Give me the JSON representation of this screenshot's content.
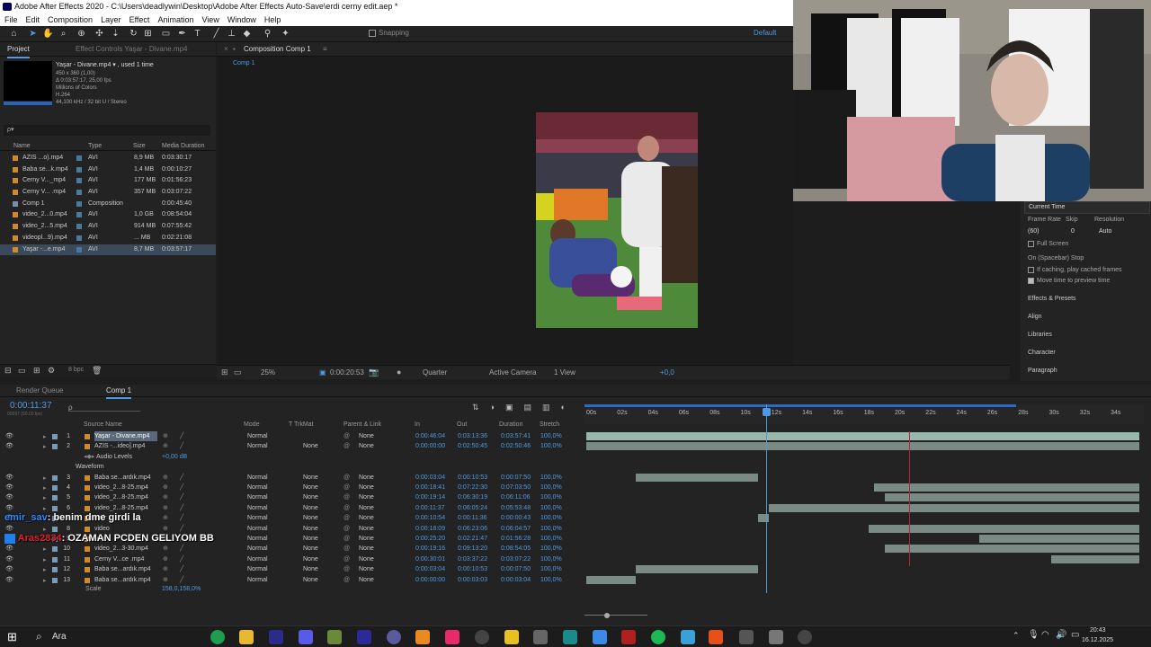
{
  "window": {
    "title": "Adobe After Effects 2020 - C:\\Users\\deadlywin\\Desktop\\Adobe After Effects Auto-Save\\erdi cerny edit.aep *"
  },
  "menu": [
    "File",
    "Edit",
    "Composition",
    "Layer",
    "Effect",
    "Animation",
    "View",
    "Window",
    "Help"
  ],
  "toolbar": {
    "snapping": "Snapping",
    "workspace": "Default"
  },
  "project": {
    "tab_project": "Project",
    "tab_effect_controls": "Effect Controls  Yaşar - Divane.mp4",
    "preview_name": "Yaşar - Divane.mp4 ▾ , used 1 time",
    "preview_info": [
      "450 x 360 (1,00)",
      "Δ 0:03:57:17, 25,00 fps",
      "Millions of Colors",
      "H.264",
      "44,100 kHz / 32 bit U / Stereo"
    ],
    "search_placeholder": "ρ▾",
    "columns": {
      "name": "Name",
      "type": "Type",
      "size": "Size",
      "duration": "Media Duration"
    },
    "items": [
      {
        "name": "AZIS ...o).mp4",
        "type": "AVI",
        "size": "8,9 MB",
        "duration": "0:03:30:17",
        "icon": "video-icon"
      },
      {
        "name": "Baba se...k.mp4",
        "type": "AVI",
        "size": "1,4 MB",
        "duration": "0:00:10:27",
        "icon": "video-icon"
      },
      {
        "name": "Cerny V..._mp4",
        "type": "AVI",
        "size": "177 MB",
        "duration": "0:01:56:23",
        "icon": "video-icon"
      },
      {
        "name": "Cerny V... .mp4",
        "type": "AVI",
        "size": "357 MB",
        "duration": "0:03:07:22",
        "icon": "video-icon"
      },
      {
        "name": "Comp 1",
        "type": "Composition",
        "size": "",
        "duration": "0:00:45:40",
        "icon": "comp-icon"
      },
      {
        "name": "video_2...0.mp4",
        "type": "AVI",
        "size": "1,0 GB",
        "duration": "0:08:54:04",
        "icon": "video-icon"
      },
      {
        "name": "video_2...5.mp4",
        "type": "AVI",
        "size": "914 MB",
        "duration": "0:07:55:42",
        "icon": "video-icon"
      },
      {
        "name": "videopl...9).mp4",
        "type": "AVI",
        "size": "... MB",
        "duration": "0:02:21:08",
        "icon": "video-icon"
      },
      {
        "name": "Yaşar -...e.mp4",
        "type": "AVI",
        "size": "8,7 MB",
        "duration": "0:03:57:17",
        "icon": "video-icon"
      }
    ],
    "bpc": "8 bpc"
  },
  "composition": {
    "tab": "Composition  Comp 1",
    "crumb": "Comp 1",
    "zoom": "25%",
    "time": "0:00:20:53",
    "resolution": "Quarter",
    "camera": "Active Camera",
    "views": "1 View",
    "exposure": "+0,0"
  },
  "right_panel": {
    "current_time": "Current Time",
    "frame_rate_label": "Frame Rate",
    "skip_label": "Skip",
    "resolution_label": "Resolution",
    "frame_rate": "(60)",
    "skip": "0",
    "resolution": "Auto",
    "full_screen": "Full Screen",
    "on_spacebar": "On (Spacebar) Stop",
    "if_caching": "If caching, play cached frames",
    "move_time": "Move time to preview time",
    "panels": [
      "Effects & Presets",
      "Align",
      "Libraries",
      "Character",
      "Paragraph"
    ]
  },
  "timeline": {
    "tab_render": "Render Queue",
    "tab_comp": "Comp 1",
    "current_time": "0:00:11:37",
    "frame_info": "00697 (60.00 fps)",
    "columns": {
      "source": "Source Name",
      "mode": "Mode",
      "trkmat": "T  TrkMat",
      "parent": "Parent & Link",
      "in": "In",
      "out": "Out",
      "duration": "Duration",
      "stretch": "Stretch"
    },
    "ruler": [
      "00s",
      "02s",
      "04s",
      "06s",
      "08s",
      "10s",
      "12s",
      "14s",
      "16s",
      "18s",
      "20s",
      "22s",
      "24s",
      "26s",
      "28s",
      "30s",
      "32s",
      "34s"
    ],
    "layers": [
      {
        "n": "1",
        "name": "Yaşar - Divane.mp4",
        "mode": "Normal",
        "trk": "",
        "parent": "None",
        "in": "0:00:46:04",
        "out": "0:03:13:36",
        "dur": "0:03:57:41",
        "str": "100,0%",
        "bar": [
          0,
          1
        ],
        "sel": true
      },
      {
        "n": "2",
        "name": "AZIS -...ideo].mp4",
        "mode": "Normal",
        "trk": "None",
        "parent": "None",
        "in": "0:00:00:00",
        "out": "0:02:50:45",
        "dur": "0:02:50:46",
        "str": "100,0%",
        "bar": [
          0,
          1
        ],
        "sel": false
      },
      {
        "n": "3",
        "name": "Baba se...ardık.mp4",
        "mode": "Normal",
        "trk": "None",
        "parent": "None",
        "in": "0:00:03:04",
        "out": "0:00:10:53",
        "dur": "0:00:07:50",
        "str": "100,0%",
        "bar": [
          0.09,
          0.31
        ],
        "sel": false
      },
      {
        "n": "4",
        "name": "video_2...8-25.mp4",
        "mode": "Normal",
        "trk": "None",
        "parent": "None",
        "in": "0:00:18:41",
        "out": "0:07:22:30",
        "dur": "0:07:03:50",
        "str": "100,0%",
        "bar": [
          0.52,
          1
        ],
        "sel": false
      },
      {
        "n": "5",
        "name": "video_2...8-25.mp4",
        "mode": "Normal",
        "trk": "None",
        "parent": "None",
        "in": "0:00:19:14",
        "out": "0:06:30:19",
        "dur": "0:06:11:06",
        "str": "100,0%",
        "bar": [
          0.54,
          1
        ],
        "sel": false
      },
      {
        "n": "6",
        "name": "video_2...8-25.mp4",
        "mode": "Normal",
        "trk": "None",
        "parent": "None",
        "in": "0:00:11:37",
        "out": "0:06:05:24",
        "dur": "0:05:53:48",
        "str": "100,0%",
        "bar": [
          0.33,
          1
        ],
        "sel": false
      },
      {
        "n": "7",
        "name": "emir",
        "mode": "Normal",
        "trk": "None",
        "parent": "None",
        "in": "0:00:10:54",
        "out": "0:00:11:36",
        "dur": "0:00:00:43",
        "str": "100,0%",
        "bar": [
          0.31,
          0.33
        ],
        "sel": false
      },
      {
        "n": "8",
        "name": "video",
        "mode": "Normal",
        "trk": "None",
        "parent": "None",
        "in": "0:00:18:09",
        "out": "0:06:23:06",
        "dur": "0:06:04:57",
        "str": "100,0%",
        "bar": [
          0.51,
          1
        ],
        "sel": false
      },
      {
        "n": "9",
        "name": "Aras",
        "mode": "Normal",
        "trk": "None",
        "parent": "None",
        "in": "0:00:25:20",
        "out": "0:02:21:47",
        "dur": "0:01:56:28",
        "str": "100,0%",
        "bar": [
          0.71,
          1
        ],
        "sel": false
      },
      {
        "n": "10",
        "name": "video_2...3-30.mp4",
        "mode": "Normal",
        "trk": "None",
        "parent": "None",
        "in": "0:00:19:16",
        "out": "0:09:13:20",
        "dur": "0:08:54:05",
        "str": "100,0%",
        "bar": [
          0.54,
          1
        ],
        "sel": false
      },
      {
        "n": "11",
        "name": "Cerny V...ce .mp4",
        "mode": "Normal",
        "trk": "None",
        "parent": "None",
        "in": "0:00:30:01",
        "out": "0:03:37:22",
        "dur": "0:03:07:22",
        "str": "100,0%",
        "bar": [
          0.84,
          1
        ],
        "sel": false
      },
      {
        "n": "12",
        "name": "Baba se...ardık.mp4",
        "mode": "Normal",
        "trk": "None",
        "parent": "None",
        "in": "0:00:03:04",
        "out": "0:00:10:53",
        "dur": "0:00:07:50",
        "str": "100,0%",
        "bar": [
          0.09,
          0.31
        ],
        "sel": false
      },
      {
        "n": "13",
        "name": "Baba se...ardık.mp4",
        "mode": "Normal",
        "trk": "None",
        "parent": "None",
        "in": "0:00:00:00",
        "out": "0:00:03:03",
        "dur": "0:00:03:04",
        "str": "100,0%",
        "bar": [
          0,
          0.09
        ],
        "sel": false
      }
    ],
    "audio_levels": "Audio Levels",
    "audio_value": "+0,00 dB",
    "waveform": "Waveform",
    "scale": "Scale",
    "scale_value": "158,0,158,0%"
  },
  "chat": [
    {
      "user": "emir_sav",
      "msg": ": benim dme girdi la"
    },
    {
      "user": "Aras2834",
      "msg": ": OZAMAN PCDEN GELIYOM BB"
    }
  ],
  "taskbar": {
    "search": "Ara",
    "time": "20:43",
    "date": "16.12.2025"
  }
}
